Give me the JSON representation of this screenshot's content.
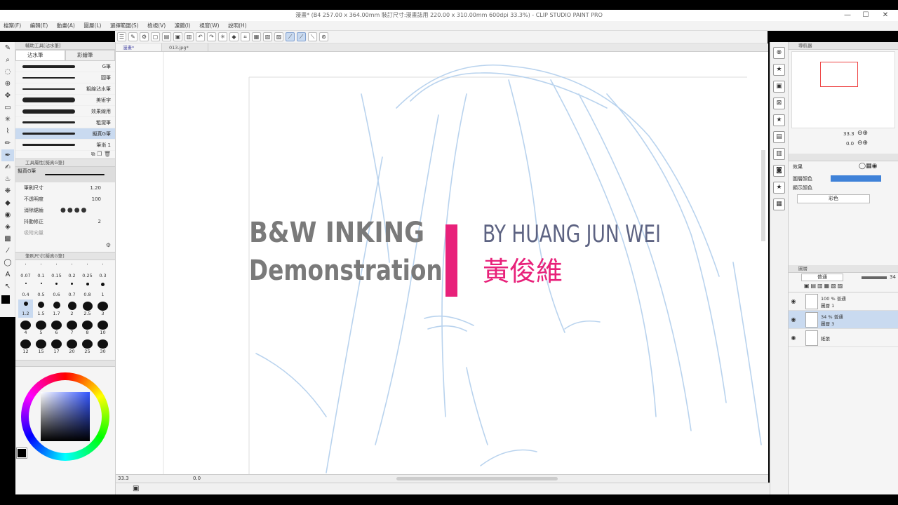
{
  "window": {
    "title": "漫畫* (B4 257.00 x 364.00mm 裝訂尺寸:漫畫誌用 220.00 x 310.00mm 600dpi 33.3%) - CLIP STUDIO PAINT PRO",
    "min": "—",
    "max": "☐",
    "close": "✕"
  },
  "menu": [
    "檔案(F)",
    "編輯(E)",
    "動畫(A)",
    "圖層(L)",
    "選擇範圍(S)",
    "檢視(V)",
    "濾鏡(I)",
    "視窗(W)",
    "說明(H)"
  ],
  "doc_tabs": [
    "漫畫*",
    "013.jpg*"
  ],
  "sub_tool": {
    "header": "輔助工具[沾水筆]",
    "tabs": [
      "沾水筆",
      "彩繪筆"
    ],
    "brushes": [
      {
        "name": "G筆",
        "w": 4
      },
      {
        "name": "圓筆",
        "w": 2
      },
      {
        "name": "粗線沾水筆",
        "w": 2
      },
      {
        "name": "美術字",
        "w": 7
      },
      {
        "name": "效果線用",
        "w": 6
      },
      {
        "name": "粗澀筆",
        "w": 3
      },
      {
        "name": "擬真G筆",
        "w": 3
      },
      {
        "name": "筆漸 1",
        "w": 3
      }
    ]
  },
  "tool_props": {
    "header": "工具屬性[擬真G筆]",
    "name": "擬真G筆",
    "brush_size_label": "筆刷尺寸",
    "brush_size_value": "1.20",
    "opacity_label": "不透明度",
    "opacity_value": "100",
    "aa_label": "消除鋸齒",
    "stab_label": "抖動修正",
    "stab_value": "2",
    "vector_label": "吸附向量"
  },
  "brush_size": {
    "header": "筆刷尺寸[擬真G筆]",
    "sizes": [
      {
        "v": "0.07",
        "d": 1
      },
      {
        "v": "0.1",
        "d": 1
      },
      {
        "v": "0.15",
        "d": 1
      },
      {
        "v": "0.2",
        "d": 1
      },
      {
        "v": "0.25",
        "d": 1
      },
      {
        "v": "0.3",
        "d": 1
      },
      {
        "v": "0.4",
        "d": 2
      },
      {
        "v": "0.5",
        "d": 2
      },
      {
        "v": "0.6",
        "d": 3
      },
      {
        "v": "0.7",
        "d": 3
      },
      {
        "v": "0.8",
        "d": 4
      },
      {
        "v": "1",
        "d": 5
      },
      {
        "v": "1.2",
        "d": 6
      },
      {
        "v": "1.5",
        "d": 9
      },
      {
        "v": "1.7",
        "d": 10
      },
      {
        "v": "2",
        "d": 12
      },
      {
        "v": "2.5",
        "d": 14
      },
      {
        "v": "3",
        "d": 15
      },
      {
        "v": "4",
        "d": 15
      },
      {
        "v": "5",
        "d": 15
      },
      {
        "v": "6",
        "d": 15
      },
      {
        "v": "7",
        "d": 15
      },
      {
        "v": "8",
        "d": 15
      },
      {
        "v": "10",
        "d": 15
      },
      {
        "v": "12",
        "d": 15
      },
      {
        "v": "15",
        "d": 15
      },
      {
        "v": "17",
        "d": 15
      },
      {
        "v": "20",
        "d": 15
      },
      {
        "v": "25",
        "d": 15
      },
      {
        "v": "30",
        "d": 15
      }
    ]
  },
  "navigator": {
    "header": "導航器",
    "zoom": "33.3",
    "angle": "0.0"
  },
  "layer_props": {
    "effect_label": "效果",
    "layer_color_label": "圖層顏色",
    "display_color_label": "顯示顏色",
    "display_color_value": "彩色"
  },
  "layers": {
    "tab": "圖層",
    "blend": "普通",
    "opacity_value": "34",
    "rows": [
      {
        "title": "100 % 普通",
        "name": "圖層 1"
      },
      {
        "title": "34 % 普通",
        "name": "圖層 3"
      },
      {
        "title": "",
        "name": "紙張"
      }
    ]
  },
  "status": {
    "zoom": "33.3",
    "angle": "0.0"
  },
  "overlay": {
    "line1": "B&W INKING",
    "line2": "Demonstration",
    "by": "BY HUANG JUN WEI",
    "cn": "黃俊維"
  },
  "colors": {
    "accent": "#e8217a",
    "byline": "#5d6382",
    "title": "#7a7a7a",
    "sketch": "#b9d3ee",
    "selected": "#c9daf0",
    "layer_color": "#3f82d8"
  }
}
